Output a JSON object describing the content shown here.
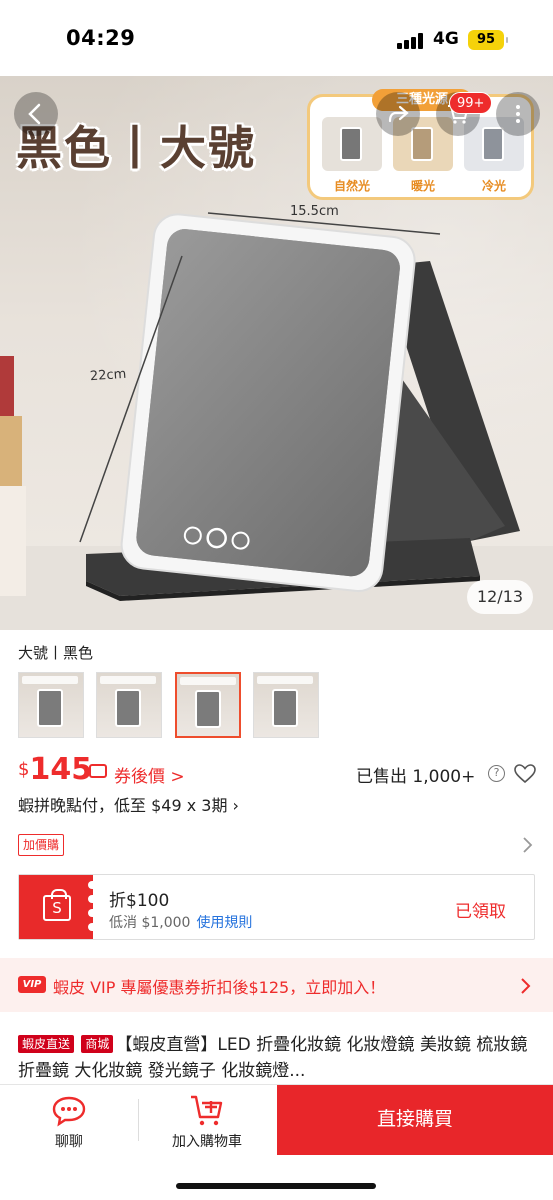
{
  "status_bar": {
    "time": "04:29",
    "network": "4G",
    "battery": "95"
  },
  "hero": {
    "product_title": "黑色丨大號",
    "light_panel_title": "三種光源",
    "light_modes": [
      "自然光",
      "暖光",
      "冷光"
    ],
    "dimension_width": "15.5cm",
    "dimension_height": "22cm",
    "cart_badge": "99+",
    "image_counter": "12/13"
  },
  "variant": {
    "selected_label": "大號丨黑色",
    "thumbnail_count": 4,
    "selected_index": 2
  },
  "price": {
    "currency": "$",
    "amount": "145",
    "after_coupon": "券後價 >",
    "sold": "已售出 1,000+",
    "installment": "蝦拼晚點付，低至 $49 x 3期 ›"
  },
  "addon": {
    "label": "加價購"
  },
  "voucher": {
    "bag_letter": "S",
    "title": "折$100",
    "min_spend": "低消 $1,000",
    "rules_link": "使用規則",
    "status": "已領取"
  },
  "vip": {
    "badge": "VIP",
    "text": "蝦皮 VIP 專屬優惠券折扣後$125，立即加入！"
  },
  "product": {
    "tags": [
      "蝦皮直送",
      "商城"
    ],
    "title": "【蝦皮直營】LED 折疊化妝鏡 化妝燈鏡 美妝鏡 梳妝鏡 折疊鏡 大化妝鏡 發光鏡子 化妝鏡燈..."
  },
  "bottom_bar": {
    "chat_label": "聊聊",
    "add_to_cart_label": "加入購物車",
    "buy_now_label": "直接購買"
  },
  "colors": {
    "accent": "#ee2c2c",
    "buy_button": "#e8262a",
    "vip_bg": "#fdf0ee",
    "link": "#2673dd"
  }
}
